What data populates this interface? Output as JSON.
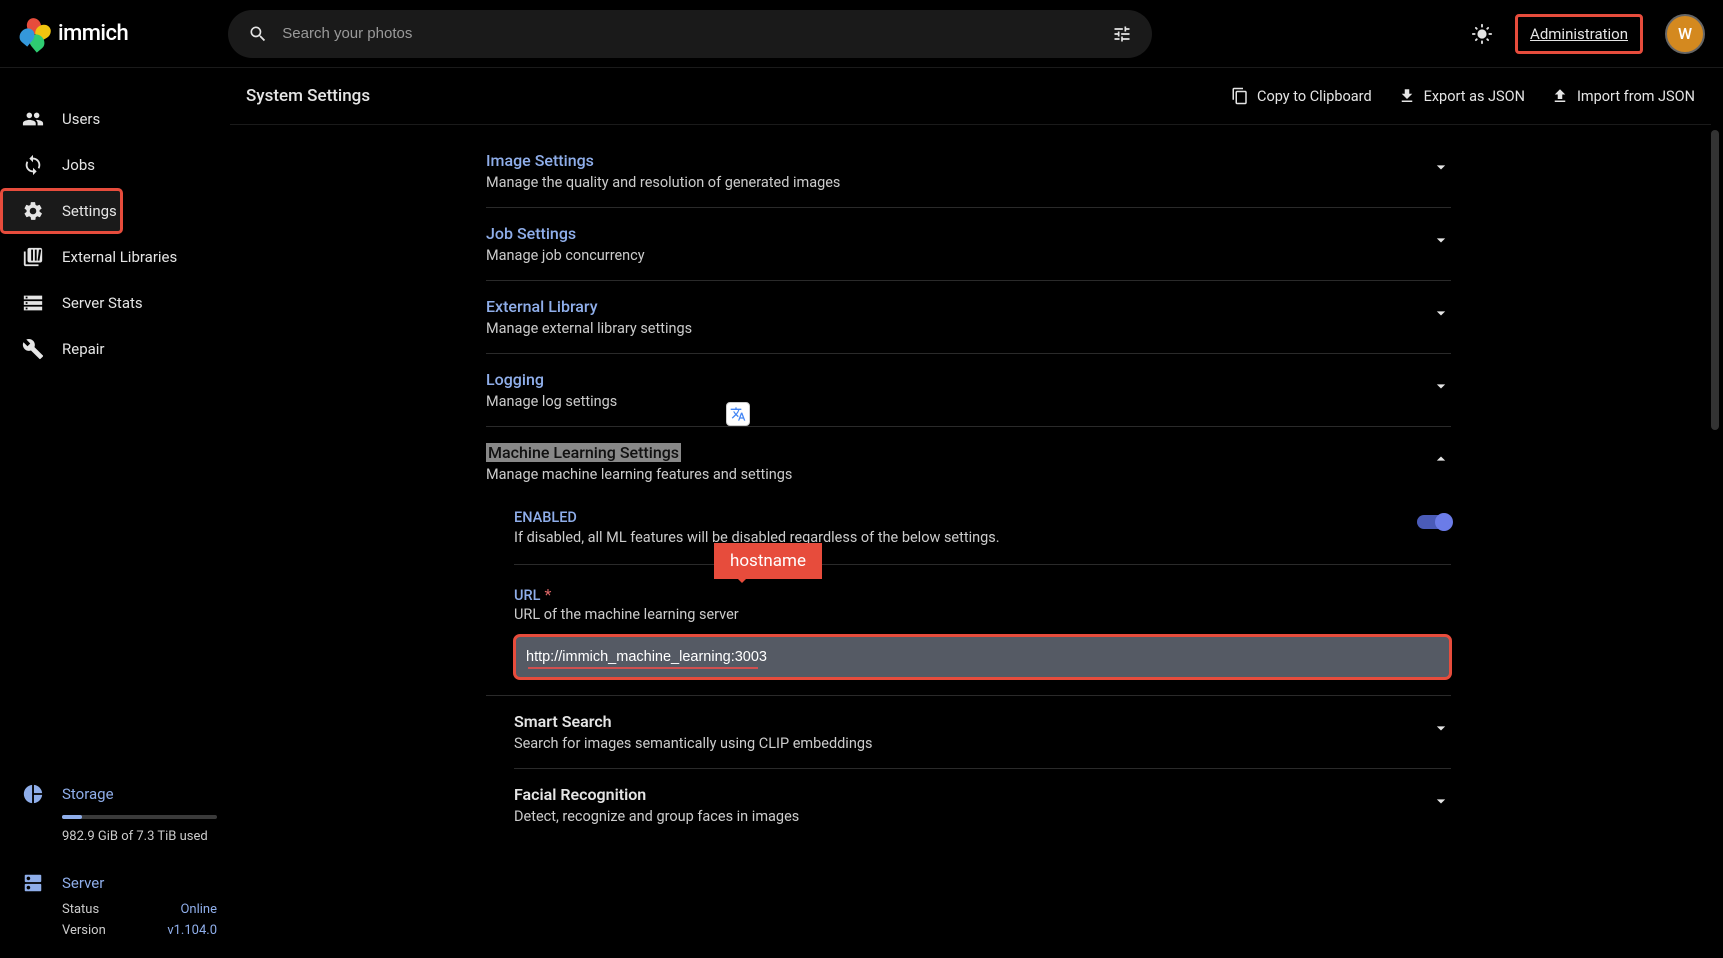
{
  "brand": "immich",
  "search": {
    "placeholder": "Search your photos"
  },
  "header": {
    "admin": "Administration",
    "avatar_initial": "W"
  },
  "sidebar": {
    "items": [
      {
        "label": "Users"
      },
      {
        "label": "Jobs"
      },
      {
        "label": "Settings"
      },
      {
        "label": "External Libraries"
      },
      {
        "label": "Server Stats"
      },
      {
        "label": "Repair"
      }
    ]
  },
  "storage": {
    "title": "Storage",
    "text": "982.9 GiB of 7.3 TiB used"
  },
  "server": {
    "title": "Server",
    "status_label": "Status",
    "status_value": "Online",
    "version_label": "Version",
    "version_value": "v1.104.0"
  },
  "page": {
    "title": "System Settings",
    "actions": {
      "copy": "Copy to Clipboard",
      "export": "Export as JSON",
      "import": "Import from JSON"
    }
  },
  "sections": {
    "image": {
      "title": "Image Settings",
      "desc": "Manage the quality and resolution of generated images"
    },
    "job": {
      "title": "Job Settings",
      "desc": "Manage job concurrency"
    },
    "extlib": {
      "title": "External Library",
      "desc": "Manage external library settings"
    },
    "logging": {
      "title": "Logging",
      "desc": "Manage log settings"
    },
    "ml": {
      "title": "Machine Learning Settings",
      "desc": "Manage machine learning features and settings",
      "enabled_label": "ENABLED",
      "enabled_desc": "If disabled, all ML features will be disabled regardless of the below settings.",
      "url_label": "URL",
      "url_desc": "URL of the machine learning server",
      "url_value": "http://immich_machine_learning:3003"
    },
    "smart": {
      "title": "Smart Search",
      "desc": "Search for images semantically using CLIP embeddings"
    },
    "facial": {
      "title": "Facial Recognition",
      "desc": "Detect, recognize and group faces in images"
    }
  },
  "callout": "hostname"
}
